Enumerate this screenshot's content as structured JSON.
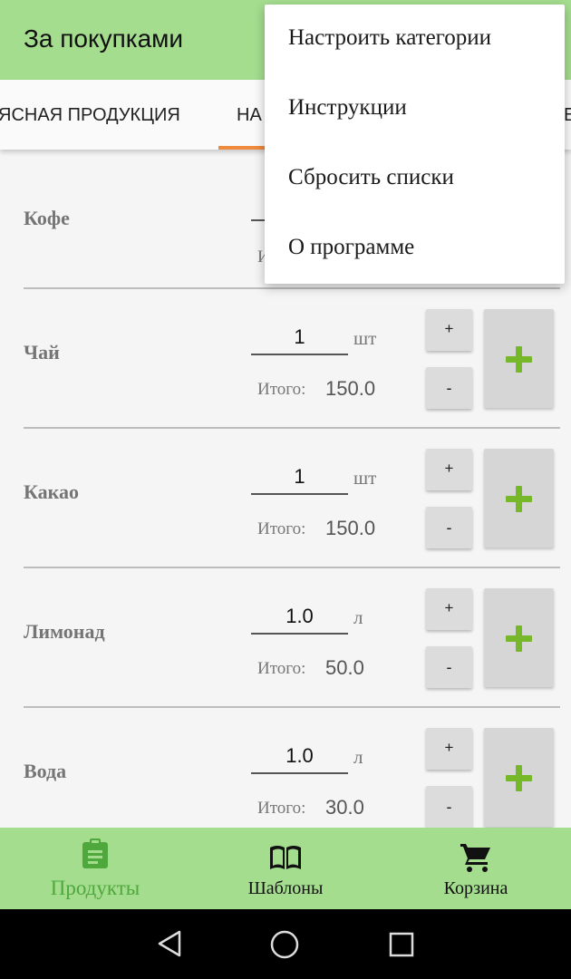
{
  "app": {
    "title": "За покупками"
  },
  "tabs": [
    "ЯСНАЯ ПРОДУКЦИЯ",
    "НА",
    "Е"
  ],
  "items": [
    {
      "name": "Кофе",
      "qty": "",
      "unit": "",
      "total_label": "И",
      "total": ""
    },
    {
      "name": "Чай",
      "qty": "1",
      "unit": "шт",
      "total_label": "Итого:",
      "total": "150.0",
      "plus": "+",
      "minus": "-"
    },
    {
      "name": "Какао",
      "qty": "1",
      "unit": "шт",
      "total_label": "Итого:",
      "total": "150.0",
      "plus": "+",
      "minus": "-"
    },
    {
      "name": "Лимонад",
      "qty": "1.0",
      "unit": "л",
      "total_label": "Итого:",
      "total": "50.0",
      "plus": "+",
      "minus": "-"
    },
    {
      "name": "Вода",
      "qty": "1.0",
      "unit": "л",
      "total_label": "Итого:",
      "total": "30.0",
      "plus": "+",
      "minus": "-"
    }
  ],
  "menu": [
    "Настроить категории",
    "Инструкции",
    "Сбросить списки",
    "О программе"
  ],
  "bottom_nav": [
    {
      "label": "Продукты",
      "icon": "clipboard-icon",
      "active": true
    },
    {
      "label": "Шаблоны",
      "icon": "book-icon",
      "active": false
    },
    {
      "label": "Корзина",
      "icon": "cart-icon",
      "active": false
    }
  ],
  "system_nav": [
    "back-icon",
    "home-icon",
    "recents-icon"
  ],
  "colors": {
    "appbar": "#a5dd8f",
    "accent_tab": "#f08a3c",
    "active_nav": "#4ea83c",
    "add_icon": "#76b82a"
  }
}
